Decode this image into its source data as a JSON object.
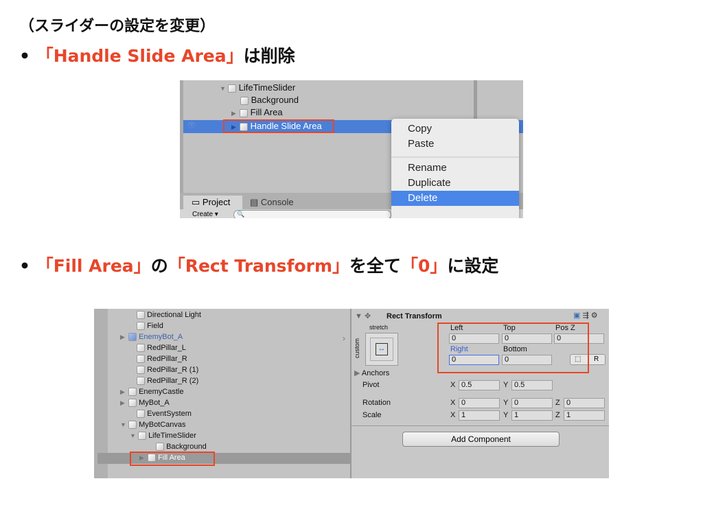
{
  "slide": {
    "heading": "（スライダーの設定を変更）",
    "bullet1": {
      "part1": "「Handle Slide Area」",
      "part2": "は削除"
    },
    "bullet2": {
      "part1": "「Fill Area」",
      "part2": "の",
      "part3": "「Rect Transform」",
      "part4": "を全て",
      "part5": "「0」",
      "part6": "に設定"
    }
  },
  "shot1": {
    "hierarchy": [
      "LifeTimeSlider",
      "Background",
      "Fill Area",
      "Handle Slide Area"
    ],
    "context_menu": [
      "Copy",
      "Paste",
      "Rename",
      "Duplicate",
      "Delete"
    ],
    "tabs": [
      "Project",
      "Console"
    ],
    "create_label": "Create"
  },
  "shot2": {
    "hierarchy": [
      {
        "label": "Directional Light"
      },
      {
        "label": "Field"
      },
      {
        "label": "EnemyBot_A"
      },
      {
        "label": "RedPillar_L"
      },
      {
        "label": "RedPillar_R"
      },
      {
        "label": "RedPillar_R (1)"
      },
      {
        "label": "RedPillar_R (2)"
      },
      {
        "label": "EnemyCastle"
      },
      {
        "label": "MyBot_A"
      },
      {
        "label": "EventSystem"
      },
      {
        "label": "MyBotCanvas"
      },
      {
        "label": "LifeTimeSlider"
      },
      {
        "label": "Background"
      },
      {
        "label": "Fill Area"
      }
    ],
    "inspector": {
      "title": "Rect Transform",
      "stretch": "stretch",
      "custom": "custom",
      "left_label": "Left",
      "top_label": "Top",
      "posz_label": "Pos Z",
      "left": "0",
      "top": "0",
      "posz": "0",
      "right_label": "Right",
      "bottom_label": "Bottom",
      "right": "0",
      "bottom": "0",
      "r_button": "R",
      "anchors": "Anchors",
      "pivot": "Pivot",
      "rotation": "Rotation",
      "scale": "Scale",
      "x": "X",
      "y": "Y",
      "z": "Z",
      "pivot_x": "0.5",
      "pivot_y": "0.5",
      "rot_x": "0",
      "rot_y": "0",
      "rot_z": "0",
      "scale_x": "1",
      "scale_y": "1",
      "scale_z": "1",
      "add_component": "Add Component"
    }
  },
  "colors": {
    "accent_red": "#e8462a",
    "selection_blue": "#3d7be0"
  }
}
